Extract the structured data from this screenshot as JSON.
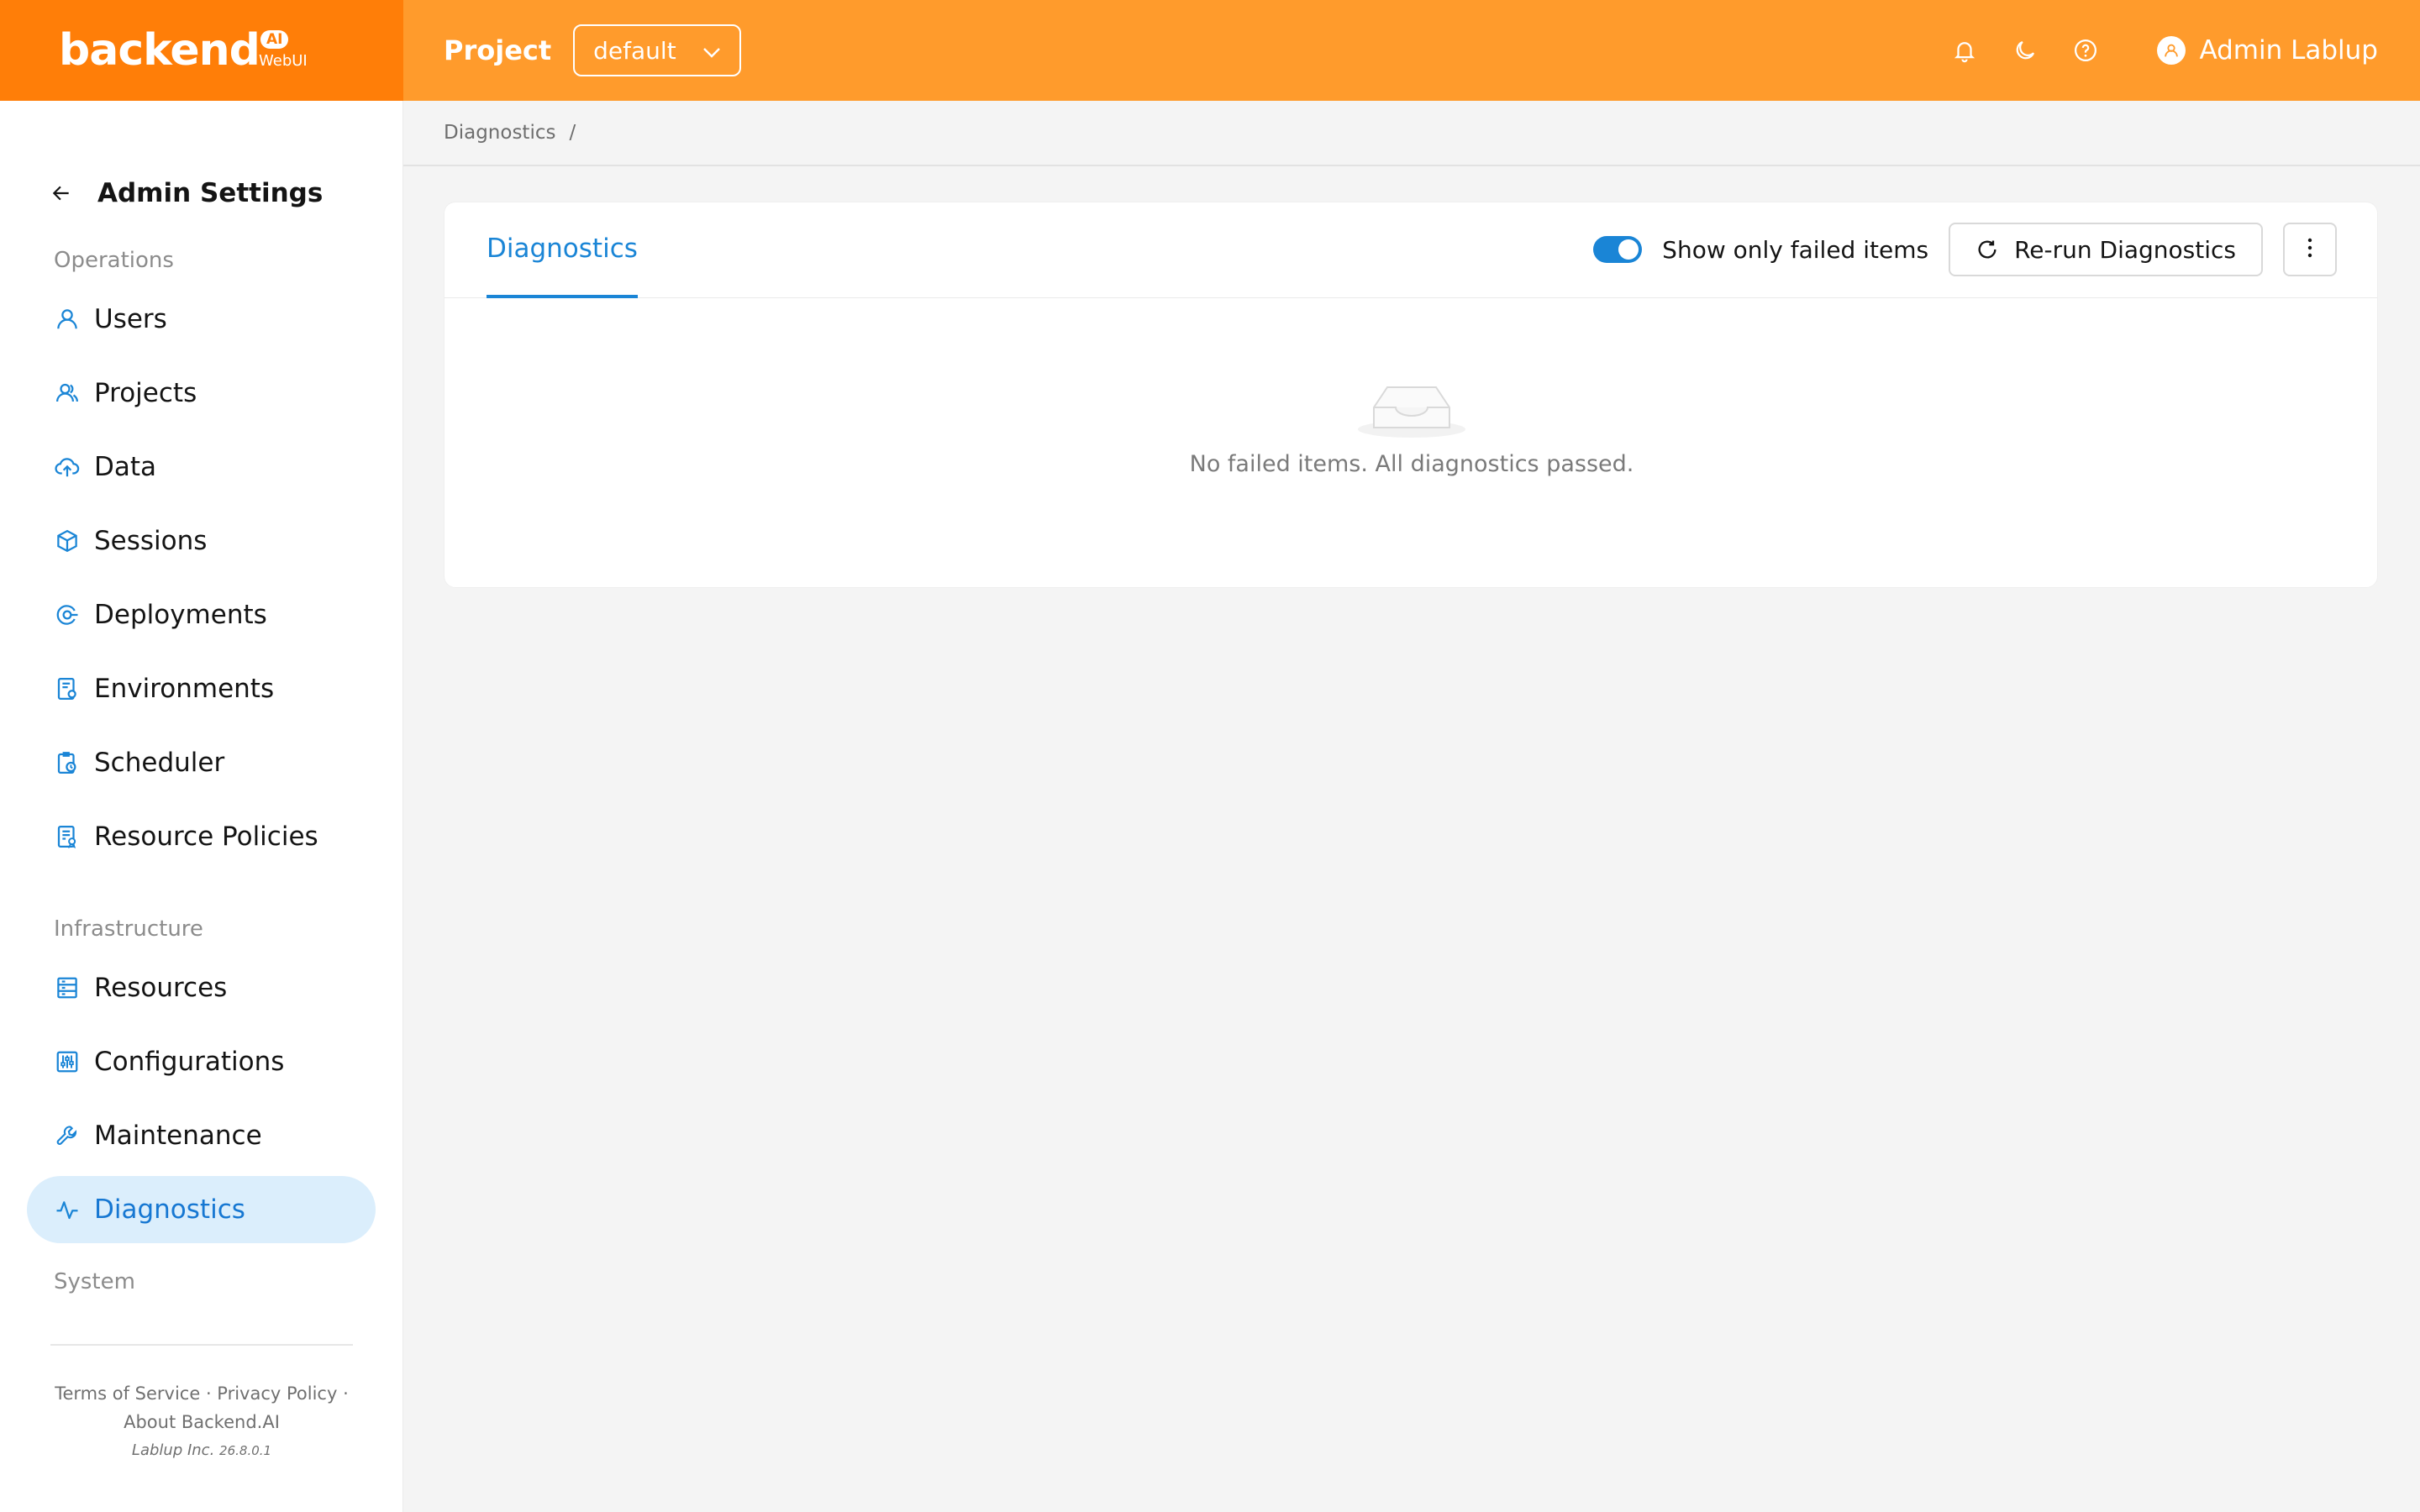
{
  "header": {
    "logo_text": "backend",
    "logo_badge": "AI",
    "logo_sub": "WebUI",
    "project_label": "Project",
    "project_value": "default",
    "user_name": "Admin Lablup",
    "icons": [
      "bell-icon",
      "moon-icon",
      "help-icon",
      "user-icon"
    ]
  },
  "sidebar": {
    "title": "Admin Settings",
    "sections": {
      "operations": "Operations",
      "infrastructure": "Infrastructure",
      "system": "System"
    },
    "items": [
      {
        "label": "Users",
        "icon": "user-icon"
      },
      {
        "label": "Projects",
        "icon": "team-icon"
      },
      {
        "label": "Data",
        "icon": "cloud-upload-icon"
      },
      {
        "label": "Sessions",
        "icon": "cube-icon"
      },
      {
        "label": "Deployments",
        "icon": "deploy-icon"
      },
      {
        "label": "Environments",
        "icon": "environment-icon"
      },
      {
        "label": "Scheduler",
        "icon": "scheduler-icon"
      },
      {
        "label": "Resource Policies",
        "icon": "policy-icon"
      },
      {
        "label": "Resources",
        "icon": "server-icon"
      },
      {
        "label": "Configurations",
        "icon": "sliders-icon"
      },
      {
        "label": "Maintenance",
        "icon": "wrench-icon"
      },
      {
        "label": "Diagnostics",
        "icon": "pulse-icon",
        "active": true
      }
    ],
    "footer": {
      "links": "Terms of Service · Privacy Policy ·",
      "about": "About Backend.AI",
      "company": "Lablup Inc.",
      "version": "26.8.0.1"
    }
  },
  "breadcrumb": {
    "current": "Diagnostics",
    "separator": "/"
  },
  "card": {
    "tab_label": "Diagnostics",
    "toggle_label": "Show only failed items",
    "toggle_on": true,
    "rerun_label": "Re-run Diagnostics",
    "empty_text": "No failed items. All diagnostics passed."
  },
  "colors": {
    "header": "#ff9b2c",
    "logo_bg": "#ff7e08",
    "accent": "#1a85d6",
    "active_bg": "#dbeefc"
  }
}
